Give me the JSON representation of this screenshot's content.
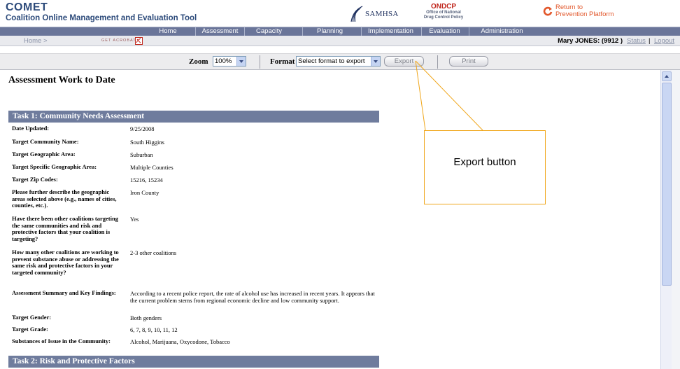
{
  "header": {
    "app_name": "COMET",
    "app_subtitle": "Coalition Online Management and Evaluation Tool",
    "samhsa": "SAMHSA",
    "ondcp_title": "ONDCP",
    "ondcp_line1": "Office of National",
    "ondcp_line2": "Drug Control Policy",
    "return_line1": "Return to",
    "return_line2": "Prevention Platform"
  },
  "nav": {
    "items": [
      "Home",
      "Assessment",
      "Capacity",
      "Planning",
      "Implementation",
      "Evaluation",
      "Administration"
    ]
  },
  "crumb": {
    "home": "Home >",
    "get_acrobat": "GET ACROBAT",
    "user": "Mary JONES: (9912 )",
    "status": "Status",
    "pipe": "|",
    "logout": "Logout"
  },
  "toolbar": {
    "zoom_label": "Zoom",
    "zoom_value": "100%",
    "format_label": "Format",
    "format_value": "Select format to export",
    "export_label": "Export",
    "print_label": "Print"
  },
  "content": {
    "page_title": "Assessment Work to Date",
    "task1_title": "Task 1: Community Needs Assessment",
    "task2_title": "Task 2: Risk and Protective Factors",
    "fields": [
      {
        "label": "Date Updated:",
        "value": "9/25/2008"
      },
      {
        "label": "Target Community Name:",
        "value": "South Higgins"
      },
      {
        "label": "Target Geographic Area:",
        "value": "Suburban"
      },
      {
        "label": "Target Specific Geographic Area:",
        "value": "Multiple Counties"
      },
      {
        "label": "Target Zip Codes:",
        "value": "15216, 15234"
      },
      {
        "label": "Please further describe the geographic areas selected above (e.g., names of cities, counties, etc.).",
        "value": "Iron County"
      },
      {
        "label": "Have there been other coalitions targeting the same communities and risk and protective factors that your coalition is targeting?",
        "value": "Yes"
      },
      {
        "label": "How many other coalitions are working to prevent substance abuse or addressing the same risk and protective factors in your targeted community?",
        "value": "2-3 other coalitions"
      },
      {
        "label": "Assessment Summary and Key Findings:",
        "value": "According to a recent police report, the rate of alcohol use has increased in recent years. It appears that the current problem stems from regional economic decline and low community support."
      },
      {
        "label": "Target Gender:",
        "value": "Both genders"
      },
      {
        "label": "Target Grade:",
        "value": "6, 7, 8, 9, 10, 11, 12"
      },
      {
        "label": "Substances of Issue in the Community:",
        "value": "Alcohol, Marijuana, Oxycodone, Tobacco"
      }
    ]
  },
  "callout": {
    "text": "Export button"
  },
  "colors": {
    "nav_bg": "#6a7599",
    "task_header_bg": "#6f7c9d",
    "callout_border": "#f0a61a",
    "brand_text": "#2c4a7a"
  }
}
